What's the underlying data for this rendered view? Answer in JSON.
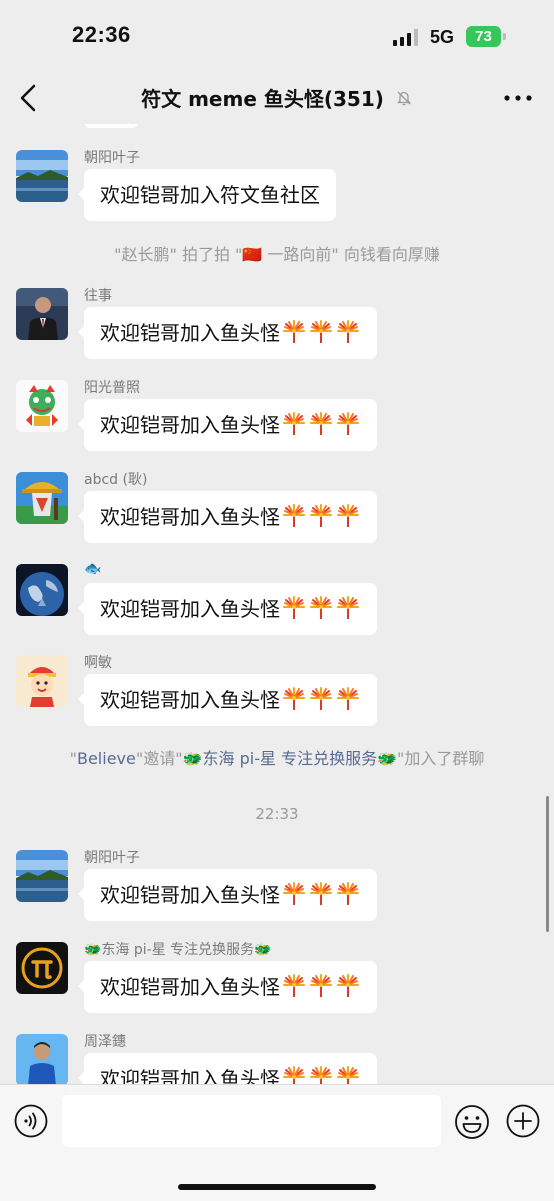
{
  "status_bar": {
    "time": "22:36",
    "network": "5G",
    "battery": "73"
  },
  "header": {
    "title": "符文 meme 鱼头怪(351)",
    "back_icon": "chevron-left-icon",
    "mute_icon": "bell-slash-icon",
    "more_icon": "ellipsis-icon"
  },
  "messages": [
    {
      "sender": "朝阳叶子",
      "text": "欢迎铠哥加入符文鱼社区",
      "avatar": "lake-landscape"
    },
    {
      "sender": "往事",
      "text": "欢迎铠哥加入鱼头怪",
      "avatar": "man-in-suit"
    },
    {
      "sender": "阳光普照",
      "text": "欢迎铠哥加入鱼头怪",
      "avatar": "lion-dance"
    },
    {
      "sender": "abcd (耿)",
      "text": "欢迎铠哥加入鱼头怪",
      "avatar": "cowboy-illustration"
    },
    {
      "sender": "🐟",
      "text": "欢迎铠哥加入鱼头怪",
      "avatar": "earth"
    },
    {
      "sender": "啊敏",
      "text": "欢迎铠哥加入鱼头怪",
      "avatar": "cartoon-kid"
    },
    {
      "sender": "朝阳叶子",
      "text": "欢迎铠哥加入鱼头怪",
      "avatar": "lake-landscape"
    },
    {
      "sender": "🐲东海 pi-星 专注兑换服务🐲",
      "text": "欢迎铠哥加入鱼头怪",
      "avatar": "pi-logo"
    },
    {
      "sender": "周泽鏸",
      "text": "欢迎铠哥加入鱼头怪",
      "avatar": "man-blue-shirt"
    }
  ],
  "bubble_icon": "firework-icon",
  "system": {
    "pat": "\"赵长鹏\" 拍了拍 \"🇨🇳 一路向前\" 向钱看向厚赚",
    "invite_q1": "\"",
    "invite_name": "Believe",
    "invite_mid": "\"邀请\"",
    "invite_target": "🐲东海 pi-星 专注兑换服务🐲",
    "invite_end": "\"加入了群聊",
    "timestamp": "22:33"
  },
  "input_bar": {
    "voice_icon": "voice-icon",
    "emoji_icon": "smiley-icon",
    "plus_icon": "plus-circle-icon"
  }
}
